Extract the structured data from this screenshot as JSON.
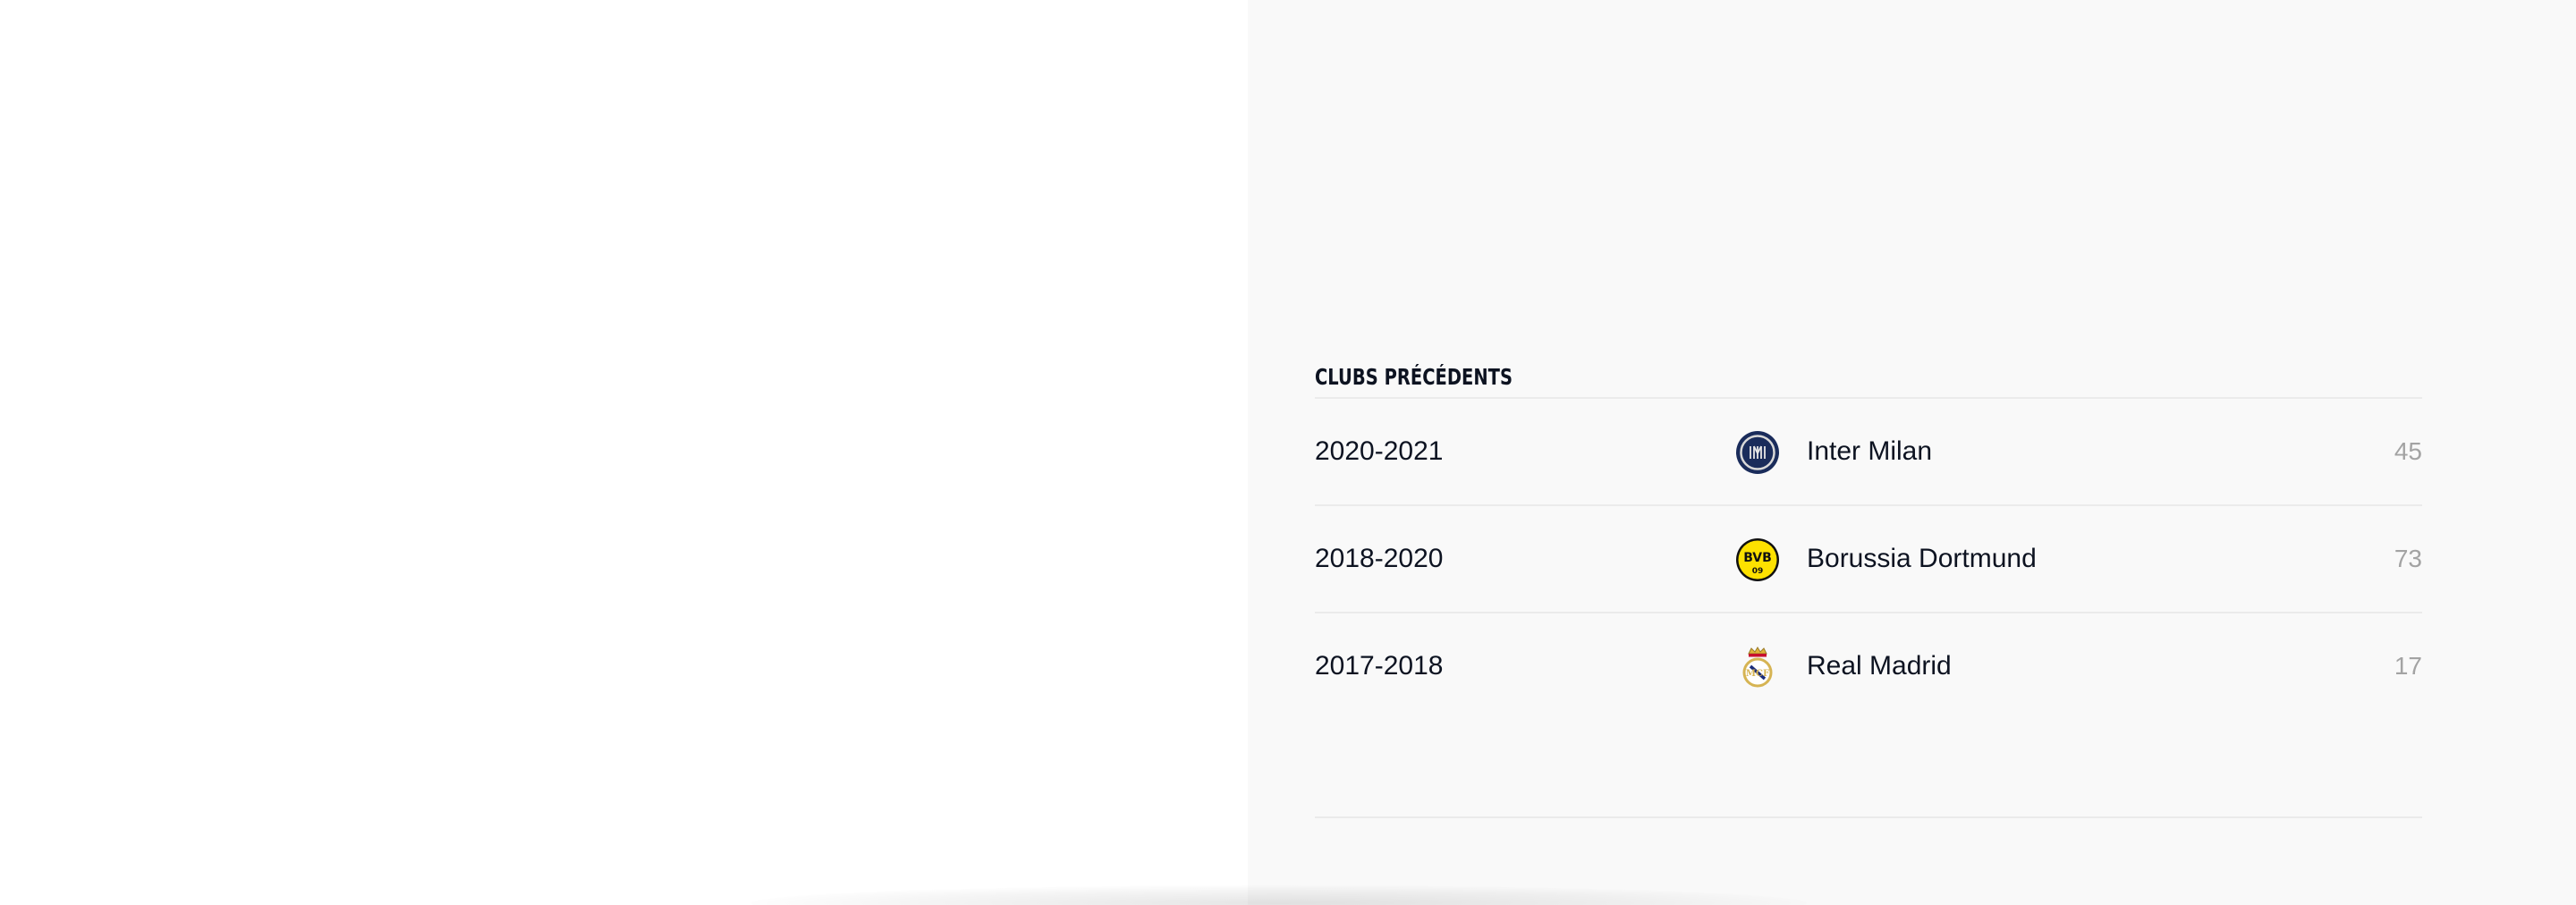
{
  "previous_clubs": {
    "title": "CLUBS PRÉCÉDENTS",
    "rows": [
      {
        "period": "2020-2021",
        "club": "Inter Milan",
        "logo_icon": "inter-milan-crest-icon",
        "appearances": "45"
      },
      {
        "period": "2018-2020",
        "club": "Borussia Dortmund",
        "logo_icon": "borussia-dortmund-crest-icon",
        "appearances": "73"
      },
      {
        "period": "2017-2018",
        "club": "Real Madrid",
        "logo_icon": "real-madrid-crest-icon",
        "appearances": "17"
      }
    ]
  },
  "colors": {
    "right_pane_background": "#f9f9f9",
    "text_primary": "#0d1321",
    "text_muted": "#a3a3a3",
    "divider": "#ebebeb"
  }
}
